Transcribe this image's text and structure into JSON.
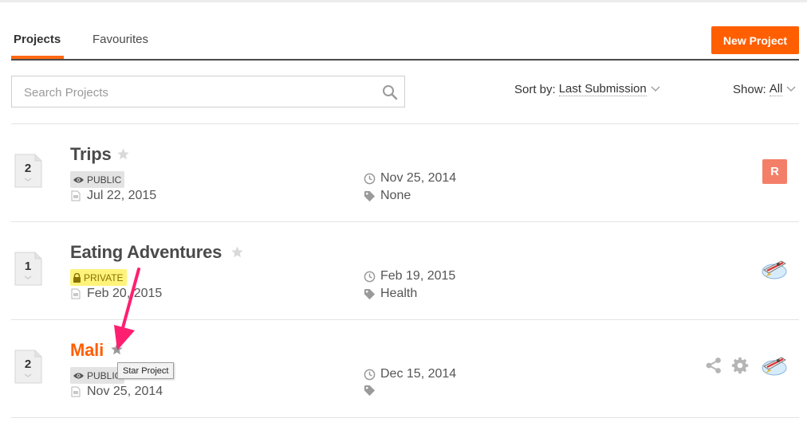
{
  "tabs": {
    "projects": "Projects",
    "favourites": "Favourites"
  },
  "new_project_label": "New Project",
  "search": {
    "placeholder": "Search Projects"
  },
  "sort": {
    "label": "Sort by:",
    "value": "Last Submission"
  },
  "show": {
    "label": "Show:",
    "value": "All"
  },
  "colors": {
    "accent": "#ff5f00",
    "private_badge": "#fff37a",
    "avatar_r": "#f47f68"
  },
  "projects": [
    {
      "count": "2",
      "name": "Trips",
      "visibility": "PUBLIC",
      "created": "Jul 22, 2015",
      "last_submission": "Nov 25, 2014",
      "tags": "None",
      "avatar": "R",
      "starred": false
    },
    {
      "count": "1",
      "name": "Eating Adventures",
      "visibility": "PRIVATE",
      "created": "Feb 20, 2015",
      "last_submission": "Feb 19, 2015",
      "tags": "Health",
      "avatar": "rocket-avatar",
      "starred": false
    },
    {
      "count": "2",
      "name": "Mali",
      "visibility": "PUBLIC",
      "created": "Nov 25, 2014",
      "last_submission": "Dec 15, 2014",
      "tags": "",
      "avatar": "rocket-avatar",
      "starred": false
    }
  ],
  "tooltip": "Star Project",
  "icons": [
    "search-icon",
    "star-icon",
    "eye-icon",
    "lock-icon",
    "document-icon",
    "clock-icon",
    "tag-icon",
    "share-icon",
    "gear-icon",
    "chevron-down-icon"
  ]
}
